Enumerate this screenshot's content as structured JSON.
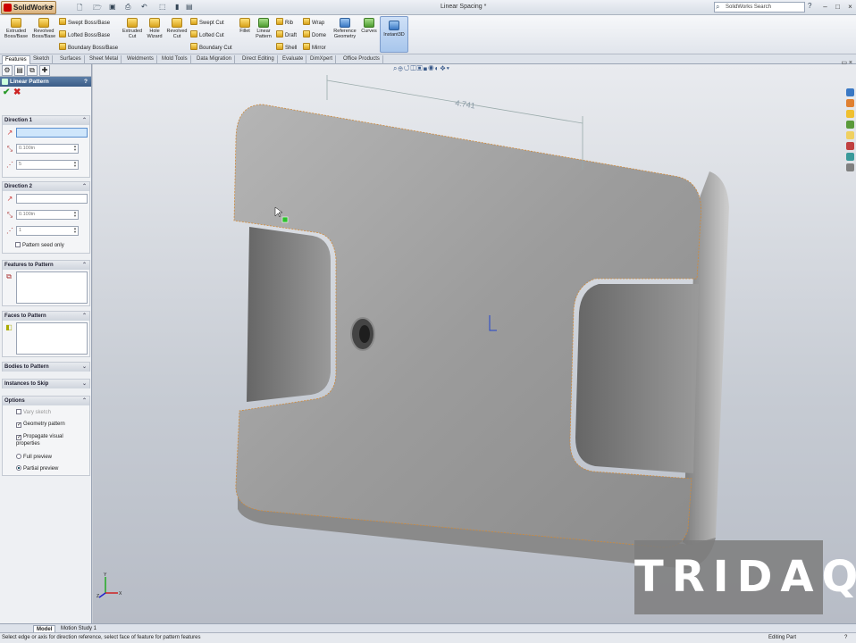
{
  "app": {
    "logo": "SolidWorks",
    "doc_title": "Linear Spacing *",
    "search_placeholder": "SolidWorks Search",
    "help": "?"
  },
  "window_controls": {
    "minimize": "–",
    "maximize": "□",
    "close": "×"
  },
  "ribbon": {
    "extruded_boss": "Extruded Boss/Base",
    "revolved_boss": "Revolved Boss/Base",
    "swept_boss": "Swept Boss/Base",
    "lofted_boss": "Lofted Boss/Base",
    "boundary_boss": "Boundary Boss/Base",
    "extruded_cut": "Extruded Cut",
    "hole_wizard": "Hole Wizard",
    "revolved_cut": "Revolved Cut",
    "swept_cut": "Swept Cut",
    "lofted_cut": "Lofted Cut",
    "boundary_cut": "Boundary Cut",
    "fillet": "Fillet",
    "linear_pattern": "Linear Pattern",
    "rib": "Rib",
    "draft": "Draft",
    "shell": "Shell",
    "wrap": "Wrap",
    "dome": "Dome",
    "mirror": "Mirror",
    "reference_geometry": "Reference Geometry",
    "curves": "Curves",
    "instant3d": "Instant3D"
  },
  "command_tabs": [
    "Features",
    "Sketch",
    "Surfaces",
    "Sheet Metal",
    "Weldments",
    "Mold Tools",
    "Data Migration",
    "Direct Editing",
    "Evaluate",
    "DimXpert",
    "Office Products"
  ],
  "property_manager": {
    "title": "Linear Pattern",
    "help": "?",
    "ok": "✔",
    "cancel": "✖",
    "direction1": {
      "label": "Direction 1",
      "ref": "",
      "distance": "0.100in",
      "instances": "5"
    },
    "direction2": {
      "label": "Direction 2",
      "ref": "",
      "distance": "0.100in",
      "instances": "1",
      "pattern_seed_only": "Pattern seed only"
    },
    "features_to_pattern": "Features to Pattern",
    "faces_to_pattern": "Faces to Pattern",
    "bodies_to_pattern": "Bodies to Pattern",
    "instances_to_skip": "Instances to Skip",
    "options": {
      "label": "Options",
      "vary_sketch": "Vary sketch",
      "geometry_pattern": "Geometry pattern",
      "propagate": "Propagate visual properties",
      "full_preview": "Full preview",
      "partial_preview": "Partial preview"
    }
  },
  "viewport": {
    "dimension": "4.741",
    "watermark": "TRIDAQ",
    "triad_x": "X",
    "triad_y": "Y",
    "triad_z": "Z"
  },
  "bottom_tabs": [
    "Model",
    "Motion Study 1"
  ],
  "status": {
    "message": "Select edge or axis for direction reference, select face of feature for pattern features",
    "mode": "Editing Part",
    "help": "?"
  },
  "colors": {
    "accent": "#3b5c86",
    "part": "#9a9a9a",
    "edge_highlight": "#d08a3a"
  }
}
